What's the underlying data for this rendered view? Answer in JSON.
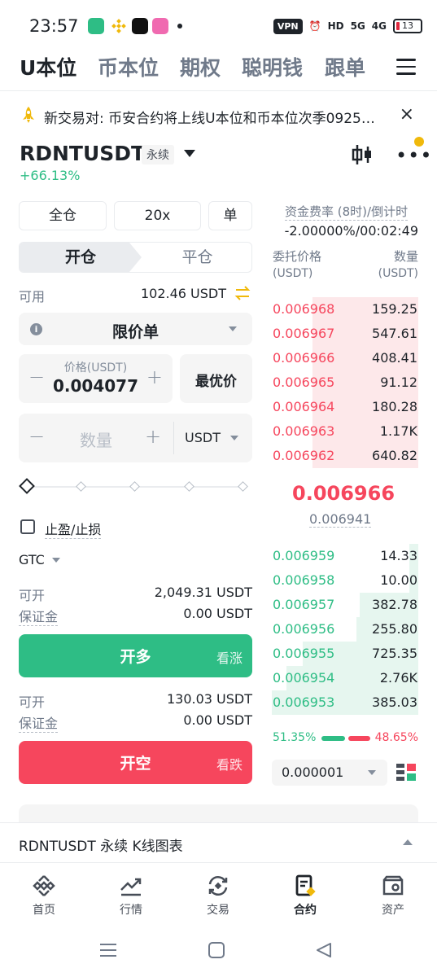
{
  "status_bar": {
    "time": "23:57",
    "vpn": "VPN",
    "hd": "HD",
    "net1": "5G",
    "net2": "4G",
    "battery": "13"
  },
  "top_tabs": [
    "U本位",
    "币本位",
    "期权",
    "聪明钱",
    "跟单"
  ],
  "announcement": {
    "text": "新交易对: 币安合约将上线U本位和币本位次季0925…",
    "close": "×"
  },
  "symbol": {
    "name": "RDNTUSDT",
    "type": "永续",
    "change": "+66.13%"
  },
  "order_form": {
    "margin_mode": "全仓",
    "leverage": "20x",
    "position_mode": "单",
    "tab_open": "开仓",
    "tab_close": "平仓",
    "available_label": "可用",
    "available_value": "102.46 USDT",
    "order_type": "限价单",
    "price_label": "价格(USDT)",
    "price_value": "0.004077",
    "best_price": "最优价",
    "quantity_placeholder": "数量",
    "quantity_unit": "USDT",
    "tpsl_label": "止盈/止损",
    "tif": "GTC",
    "long": {
      "can_open_label": "可开",
      "can_open_value": "2,049.31 USDT",
      "margin_label": "保证金",
      "margin_value": "0.00 USDT",
      "button": "开多",
      "button_sub": "看涨"
    },
    "short": {
      "can_open_label": "可开",
      "can_open_value": "130.03 USDT",
      "margin_label": "保证金",
      "margin_value": "0.00 USDT",
      "button": "开空",
      "button_sub": "看跌"
    }
  },
  "order_book": {
    "funding_label": "资金费率 (8时)/倒计时",
    "funding_value": "-2.00000%/00:02:49",
    "price_header": "委托价格",
    "price_unit": "(USDT)",
    "qty_header": "数量",
    "qty_unit": "(USDT)",
    "asks": [
      {
        "price": "0.006968",
        "qty": "159.25",
        "depth": 0.72
      },
      {
        "price": "0.006967",
        "qty": "547.61",
        "depth": 0.72
      },
      {
        "price": "0.006966",
        "qty": "408.41",
        "depth": 0.72
      },
      {
        "price": "0.006965",
        "qty": "91.12",
        "depth": 0.72
      },
      {
        "price": "0.006964",
        "qty": "180.28",
        "depth": 0.72
      },
      {
        "price": "0.006963",
        "qty": "1.17K",
        "depth": 0.72
      },
      {
        "price": "0.006962",
        "qty": "640.82",
        "depth": 0.72
      }
    ],
    "last_price": "0.006966",
    "mark_price": "0.006941",
    "bids": [
      {
        "price": "0.006959",
        "qty": "14.33",
        "depth": 0.06
      },
      {
        "price": "0.006958",
        "qty": "10.00",
        "depth": 0.06
      },
      {
        "price": "0.006957",
        "qty": "382.78",
        "depth": 0.4
      },
      {
        "price": "0.006956",
        "qty": "255.80",
        "depth": 0.42
      },
      {
        "price": "0.006955",
        "qty": "725.35",
        "depth": 0.79
      },
      {
        "price": "0.006954",
        "qty": "2.76K",
        "depth": 0.9
      },
      {
        "price": "0.006953",
        "qty": "385.03",
        "depth": 1.0
      }
    ],
    "buy_ratio": "51.35%",
    "sell_ratio": "48.65%",
    "precision": "0.000001"
  },
  "kline_bar": "RDNTUSDT 永续 K线图表",
  "bottom_nav": [
    "首页",
    "行情",
    "交易",
    "合约",
    "资产"
  ],
  "colors": {
    "green": "#2ebd85",
    "red": "#f6465d",
    "yellow": "#f0b90b"
  }
}
